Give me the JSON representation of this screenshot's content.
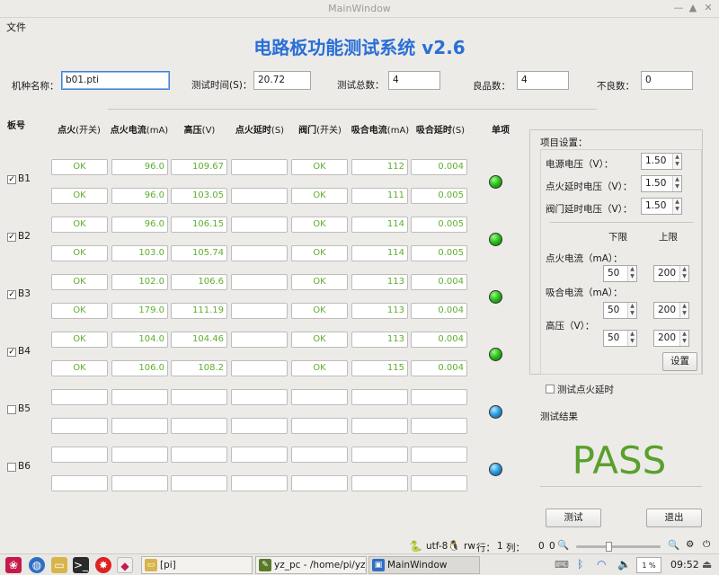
{
  "window": {
    "title": "MainWindow"
  },
  "menu": {
    "file": "文件"
  },
  "app_title": "电路板功能测试系统 v2.6",
  "header_fields": {
    "model_label": "机种名称：",
    "model_value": "b01.pti",
    "time_label": "测试时间(S)：",
    "time_value": "20.72",
    "total_label": "测试总数：",
    "total_value": "4",
    "good_label": "良品数：",
    "good_value": "4",
    "bad_label": "不良数：",
    "bad_value": "0"
  },
  "table": {
    "board_header": "板号",
    "single_header": "单项",
    "columns": [
      {
        "main": "点火",
        "unit": "(开关)"
      },
      {
        "main": "点火电流",
        "unit": "(mA)"
      },
      {
        "main": "高压",
        "unit": "(V)"
      },
      {
        "main": "点火延时",
        "unit": "(S)"
      },
      {
        "main": "阀门",
        "unit": "(开关)"
      },
      {
        "main": "吸合电流",
        "unit": "(mA)"
      },
      {
        "main": "吸合延时",
        "unit": "(S)"
      }
    ],
    "boards": [
      {
        "label": "B1",
        "checked": true,
        "led": "green",
        "rows": [
          [
            "OK",
            "96.0",
            "109.67",
            "",
            "OK",
            "112",
            "0.004"
          ],
          [
            "OK",
            "96.0",
            "103.05",
            "",
            "OK",
            "111",
            "0.005"
          ]
        ]
      },
      {
        "label": "B2",
        "checked": true,
        "led": "green",
        "rows": [
          [
            "OK",
            "96.0",
            "106.15",
            "",
            "OK",
            "114",
            "0.005"
          ],
          [
            "OK",
            "103.0",
            "105.74",
            "",
            "OK",
            "114",
            "0.005"
          ]
        ]
      },
      {
        "label": "B3",
        "checked": true,
        "led": "green",
        "rows": [
          [
            "OK",
            "102.0",
            "106.6",
            "",
            "OK",
            "113",
            "0.004"
          ],
          [
            "OK",
            "179.0",
            "111.19",
            "",
            "OK",
            "113",
            "0.004"
          ]
        ]
      },
      {
        "label": "B4",
        "checked": true,
        "led": "green",
        "rows": [
          [
            "OK",
            "104.0",
            "104.46",
            "",
            "OK",
            "113",
            "0.004"
          ],
          [
            "OK",
            "106.0",
            "108.2",
            "",
            "OK",
            "115",
            "0.004"
          ]
        ]
      },
      {
        "label": "B5",
        "checked": false,
        "led": "blue",
        "rows": [
          [
            "",
            "",
            "",
            "",
            "",
            "",
            ""
          ],
          [
            "",
            "",
            "",
            "",
            "",
            "",
            ""
          ]
        ]
      },
      {
        "label": "B6",
        "checked": false,
        "led": "blue",
        "rows": [
          [
            "",
            "",
            "",
            "",
            "",
            "",
            ""
          ],
          [
            "",
            "",
            "",
            "",
            "",
            "",
            ""
          ]
        ]
      }
    ],
    "check_glyph": "✓"
  },
  "settings": {
    "group_title": "项目设置：",
    "supply_voltage_label": "电源电压（V）：",
    "supply_voltage_value": "1.50",
    "ignite_delay_voltage_label": "点火延时电压（V）：",
    "ignite_delay_voltage_value": "1.50",
    "valve_delay_voltage_label": "阀门延时电压（V）：",
    "valve_delay_voltage_value": "1.50",
    "lower_label": "下限",
    "upper_label": "上限",
    "ignite_current_label": "点火电流（mA）：",
    "ignite_current_lower": "50",
    "ignite_current_upper": "200",
    "hold_current_label": "吸合电流（mA）：",
    "hold_current_lower": "50",
    "hold_current_upper": "200",
    "high_voltage_label": "高压（V）：",
    "high_voltage_lower": "50",
    "high_voltage_upper": "200",
    "set_button": "设置"
  },
  "test_ignite_delay_label": "测试点火延时",
  "result_label": "测试结果",
  "result_value": "PASS",
  "buttons": {
    "test": "测试",
    "exit": "退出"
  },
  "statusbar": {
    "encoding": "utf-8",
    "mode": "rw",
    "line_label": "行：",
    "line_value": "1",
    "col_label": "列：",
    "col_value": "0",
    "zoom_value": "0"
  },
  "taskbar": {
    "tasks": [
      {
        "label": "[pi]"
      },
      {
        "label": "yz_pc - /home/pi/yz_..."
      },
      {
        "label": "MainWindow"
      }
    ],
    "clock": "09:52",
    "cpu": "1 %"
  },
  "colors": {
    "title_blue": "#2b6fd6",
    "value_green": "#5fae2e",
    "pass_green": "#5aa02c",
    "led_green": "#2ec21a",
    "led_blue": "#2f9fe0"
  }
}
